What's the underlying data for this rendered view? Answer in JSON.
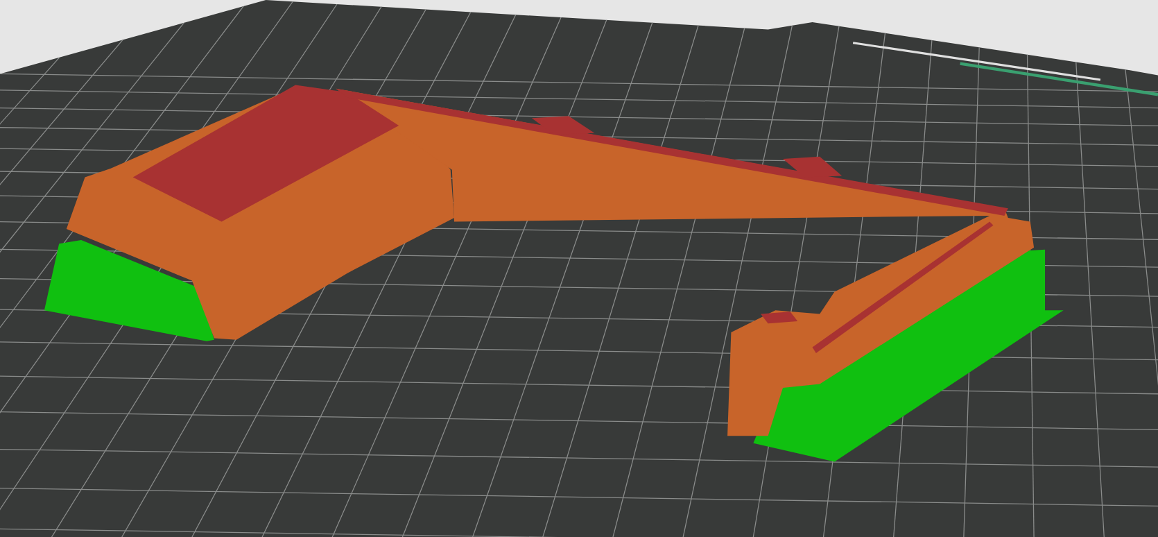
{
  "scene": {
    "features": [
      {
        "kind": "perimeter",
        "color": "#c8642a"
      },
      {
        "kind": "top",
        "color": "#a83232"
      },
      {
        "kind": "support",
        "color": "#10c010"
      }
    ]
  }
}
